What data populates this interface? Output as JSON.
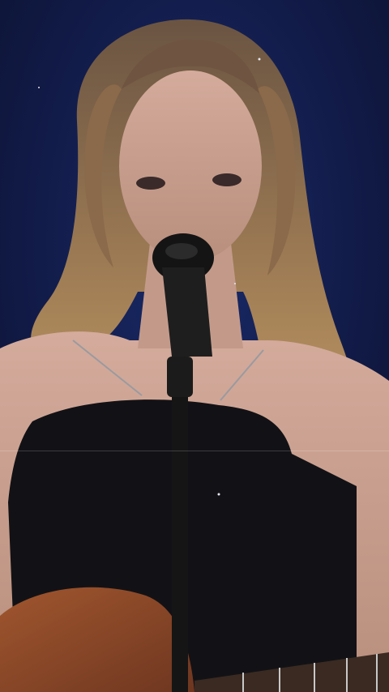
{
  "scene": {
    "subject": "singer-with-microphone-and-guitar",
    "colors": {
      "background": "#0b1230",
      "stage_glow": "#1a2b6b",
      "hair_dark": "#5a4636",
      "hair_light": "#b89466",
      "skin": "#c9a292",
      "dress": "#121216",
      "guitar_body": "#8a4a2a",
      "guitar_neck": "#3a2a22",
      "mic_stand": "#151515"
    }
  }
}
